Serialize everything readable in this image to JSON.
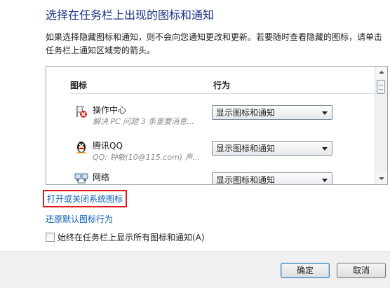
{
  "title": "选择在任务栏上出现的图标和通知",
  "description": "如果选择隐藏图标和通知，则不会向您通知更改和更新。若要随时查看隐藏的图标，请单击任务栏上通知区域旁的箭头。",
  "table": {
    "col_icons": "图标",
    "col_behavior": "行为",
    "rows": [
      {
        "icon": "action-center-icon",
        "name": "操作中心",
        "sub": "解决 PC 问题  3 条重要消息...",
        "behavior": "显示图标和通知"
      },
      {
        "icon": "qq-penguin-icon",
        "name": "腾讯QQ",
        "sub": "QQ: 钟敏(10@115.com)  声...",
        "behavior": "显示图标和通知"
      },
      {
        "icon": "network-icon",
        "name": "网络",
        "sub": "",
        "behavior": "显示图标和通知"
      }
    ]
  },
  "links": {
    "system_icons": "打开或关闭系统图标",
    "restore": "还原默认图标行为"
  },
  "checkbox": {
    "label": "始终在任务栏上显示所有图标和通知(A)",
    "checked": false
  },
  "buttons": {
    "ok": "确定",
    "cancel": "取消"
  },
  "colors": {
    "title": "#1e3287",
    "link": "#0b5db8",
    "highlight_box": "#e01a1a"
  }
}
